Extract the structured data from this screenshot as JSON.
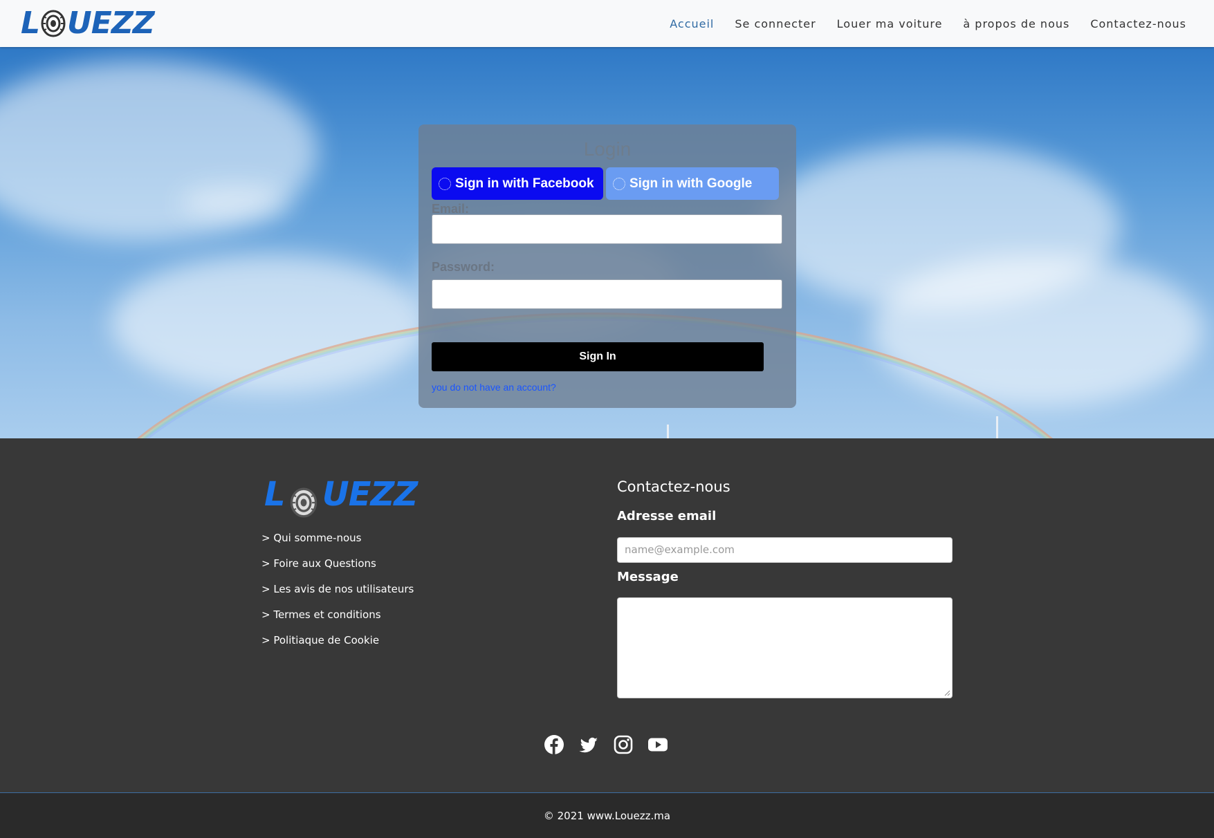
{
  "brand": {
    "logo_left": "L",
    "logo_right": "UEZZ"
  },
  "nav": {
    "items": [
      {
        "label": "Accueil",
        "active": true
      },
      {
        "label": "Se connecter",
        "active": false
      },
      {
        "label": "Louer ma voiture",
        "active": false
      },
      {
        "label": "à propos de nous",
        "active": false
      },
      {
        "label": "Contactez-nous",
        "active": false
      }
    ]
  },
  "login": {
    "title": "Login",
    "facebook_label": "Sign in with Facebook",
    "google_label": "Sign in with Google",
    "email_label": "Email:",
    "email_value": "",
    "password_label": "Password:",
    "password_value": "",
    "submit_label": "Sign In",
    "register_link": "you do not have an account?"
  },
  "footer": {
    "links": [
      "> Qui somme-nous",
      "> Foire aux Questions",
      "> Les avis de nos utilisateurs",
      "> Termes et conditions",
      "> Politiaque de Cookie"
    ],
    "contact_title": "Contactez-nous",
    "email_label": "Adresse email",
    "email_placeholder": "name@example.com",
    "message_label": "Message",
    "socials": [
      "facebook-icon",
      "twitter-icon",
      "instagram-icon",
      "youtube-icon"
    ],
    "copyright": "© 2021 www.Louezz.ma"
  },
  "colors": {
    "brand_blue": "#1d63b8",
    "nav_active": "#2f6aa3",
    "facebook_button": "#0b0bf0",
    "google_button": "#6a9cf2",
    "footer_bg": "#383838"
  }
}
